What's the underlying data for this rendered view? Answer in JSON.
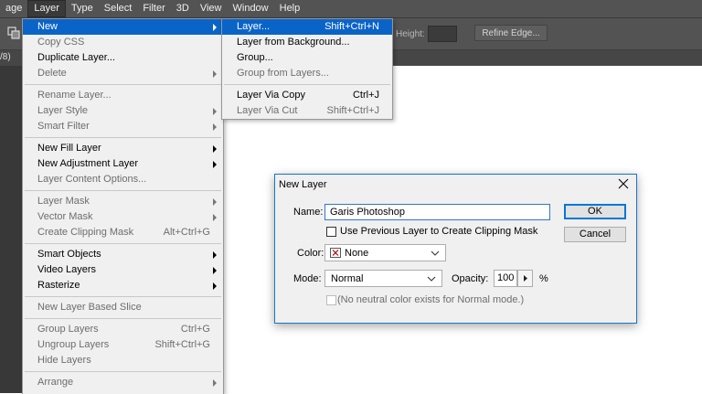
{
  "menubar": {
    "items": [
      {
        "label": "age"
      },
      {
        "label": "Layer"
      },
      {
        "label": "Type"
      },
      {
        "label": "Select"
      },
      {
        "label": "Filter"
      },
      {
        "label": "3D"
      },
      {
        "label": "View"
      },
      {
        "label": "Window"
      },
      {
        "label": "Help"
      }
    ],
    "active_index": 1
  },
  "options_bar": {
    "tool_icon": "move-arrange-icon",
    "height_label": "Height:",
    "refine_edge_label": "Refine Edge..."
  },
  "doc_tab": {
    "fragment": "/8)"
  },
  "layer_menu": {
    "items": [
      {
        "label": "New",
        "shortcut": "",
        "submenu": true,
        "disabled": false,
        "highlighted": true
      },
      {
        "label": "Copy CSS",
        "shortcut": "",
        "submenu": false,
        "disabled": true
      },
      {
        "label": "Duplicate Layer...",
        "shortcut": "",
        "submenu": false,
        "disabled": false
      },
      {
        "label": "Delete",
        "shortcut": "",
        "submenu": true,
        "disabled": true
      },
      {
        "separator": true
      },
      {
        "label": "Rename Layer...",
        "shortcut": "",
        "submenu": false,
        "disabled": true
      },
      {
        "label": "Layer Style",
        "shortcut": "",
        "submenu": true,
        "disabled": true
      },
      {
        "label": "Smart Filter",
        "shortcut": "",
        "submenu": true,
        "disabled": true
      },
      {
        "separator": true
      },
      {
        "label": "New Fill Layer",
        "shortcut": "",
        "submenu": true,
        "disabled": false
      },
      {
        "label": "New Adjustment Layer",
        "shortcut": "",
        "submenu": true,
        "disabled": false
      },
      {
        "label": "Layer Content Options...",
        "shortcut": "",
        "submenu": false,
        "disabled": true
      },
      {
        "separator": true
      },
      {
        "label": "Layer Mask",
        "shortcut": "",
        "submenu": true,
        "disabled": true
      },
      {
        "label": "Vector Mask",
        "shortcut": "",
        "submenu": true,
        "disabled": true
      },
      {
        "label": "Create Clipping Mask",
        "shortcut": "Alt+Ctrl+G",
        "submenu": false,
        "disabled": true
      },
      {
        "separator": true
      },
      {
        "label": "Smart Objects",
        "shortcut": "",
        "submenu": true,
        "disabled": false
      },
      {
        "label": "Video Layers",
        "shortcut": "",
        "submenu": true,
        "disabled": false
      },
      {
        "label": "Rasterize",
        "shortcut": "",
        "submenu": true,
        "disabled": false
      },
      {
        "separator": true
      },
      {
        "label": "New Layer Based Slice",
        "shortcut": "",
        "submenu": false,
        "disabled": true
      },
      {
        "separator": true
      },
      {
        "label": "Group Layers",
        "shortcut": "Ctrl+G",
        "submenu": false,
        "disabled": true
      },
      {
        "label": "Ungroup Layers",
        "shortcut": "Shift+Ctrl+G",
        "submenu": false,
        "disabled": true
      },
      {
        "label": "Hide Layers",
        "shortcut": "",
        "submenu": false,
        "disabled": true
      },
      {
        "separator": true
      },
      {
        "label": "Arrange",
        "shortcut": "",
        "submenu": true,
        "disabled": true
      }
    ]
  },
  "new_submenu": {
    "items": [
      {
        "label": "Layer...",
        "shortcut": "Shift+Ctrl+N",
        "disabled": false,
        "highlighted": true
      },
      {
        "label": "Layer from Background...",
        "shortcut": "",
        "disabled": false
      },
      {
        "label": "Group...",
        "shortcut": "",
        "disabled": false
      },
      {
        "label": "Group from Layers...",
        "shortcut": "",
        "disabled": true
      },
      {
        "separator": true
      },
      {
        "label": "Layer Via Copy",
        "shortcut": "Ctrl+J",
        "disabled": false
      },
      {
        "label": "Layer Via Cut",
        "shortcut": "Shift+Ctrl+J",
        "disabled": true
      }
    ]
  },
  "dialog": {
    "title": "New Layer",
    "name_label": "Name:",
    "name_value": "Garis Photoshop",
    "clipping_label": "Use Previous Layer to Create Clipping Mask",
    "color_label": "Color:",
    "color_value": "None",
    "mode_label": "Mode:",
    "mode_value": "Normal",
    "opacity_label": "Opacity:",
    "opacity_value": "100",
    "opacity_unit": "%",
    "neutral_label": "(No neutral color exists for Normal mode.)",
    "ok_label": "OK",
    "cancel_label": "Cancel"
  },
  "colors": {
    "menubar_bg": "#535353",
    "menu_bg": "#f0f0f0",
    "highlight": "#0a64c8",
    "dialog_border": "#1a74c6"
  }
}
